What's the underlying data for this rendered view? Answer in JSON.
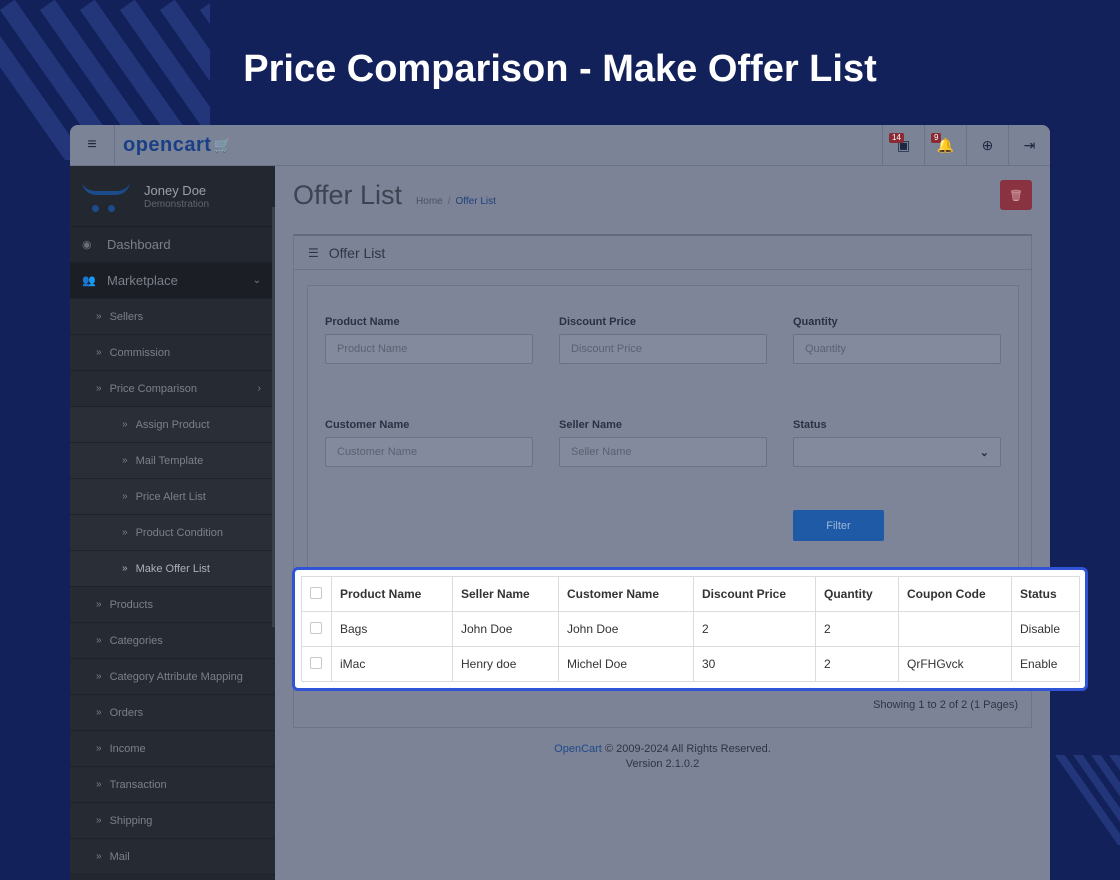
{
  "hero": {
    "title": "Price Comparison - Make Offer List"
  },
  "topbar": {
    "logo": "opencart",
    "logo_cart": "🛒",
    "menu_icon": "≡",
    "badges": {
      "stores": "14",
      "alerts": "9"
    },
    "icons": {
      "stores": "▣",
      "bell": "🔔",
      "help": "⊕",
      "logout": "⇥"
    }
  },
  "sidebar": {
    "profile": {
      "name": "Joney Doe",
      "role": "Demonstration"
    },
    "dashboard": {
      "label": "Dashboard",
      "icon": "◉"
    },
    "marketplace": {
      "label": "Marketplace",
      "icon": "👥",
      "caret": "⌄"
    },
    "items": [
      {
        "label": "Sellers"
      },
      {
        "label": "Commission"
      },
      {
        "label": "Price Comparison",
        "caret": "›"
      }
    ],
    "pc_items": [
      {
        "label": "Assign Product"
      },
      {
        "label": "Mail Template"
      },
      {
        "label": "Price Alert List"
      },
      {
        "label": "Product Condition"
      },
      {
        "label": "Make Offer List"
      }
    ],
    "more_items": [
      {
        "label": "Products"
      },
      {
        "label": "Categories"
      },
      {
        "label": "Category Attribute Mapping"
      },
      {
        "label": "Orders"
      },
      {
        "label": "Income"
      },
      {
        "label": "Transaction"
      },
      {
        "label": "Shipping"
      },
      {
        "label": "Mail"
      }
    ],
    "chevron": "»"
  },
  "page": {
    "title": "Offer List",
    "breadcrumb": {
      "home": "Home",
      "sep": "/",
      "current": "Offer List"
    },
    "delete_icon": "🗑"
  },
  "panel": {
    "title": "Offer List",
    "icon": "☰"
  },
  "filters": {
    "product_name": {
      "label": "Product Name",
      "placeholder": "Product  Name"
    },
    "discount_price": {
      "label": "Discount Price",
      "placeholder": "Discount Price"
    },
    "quantity": {
      "label": "Quantity",
      "placeholder": "Quantity"
    },
    "customer_name": {
      "label": "Customer Name",
      "placeholder": "Customer Name"
    },
    "seller_name": {
      "label": "Seller Name",
      "placeholder": "Seller Name"
    },
    "status": {
      "label": "Status",
      "value": "",
      "arrow": "⌄"
    },
    "button": "Filter"
  },
  "table": {
    "headers": [
      "Product Name",
      "Seller Name",
      "Customer Name",
      "Discount Price",
      "Quantity",
      "Coupon Code",
      "Status"
    ],
    "rows": [
      {
        "product": "Bags",
        "seller": "John Doe",
        "customer": "John Doe",
        "price": "2",
        "qty": "2",
        "coupon": "",
        "status": "Disable"
      },
      {
        "product": "iMac",
        "seller": "Henry doe",
        "customer": "Michel Doe",
        "price": "30",
        "qty": "2",
        "coupon": "QrFHGvck",
        "status": "Enable"
      }
    ],
    "summary": "Showing 1 to 2 of 2 (1 Pages)"
  },
  "footer": {
    "brand": "OpenCart",
    "rights": "© 2009-2024 All Rights Reserved.",
    "version": "Version 2.1.0.2"
  }
}
